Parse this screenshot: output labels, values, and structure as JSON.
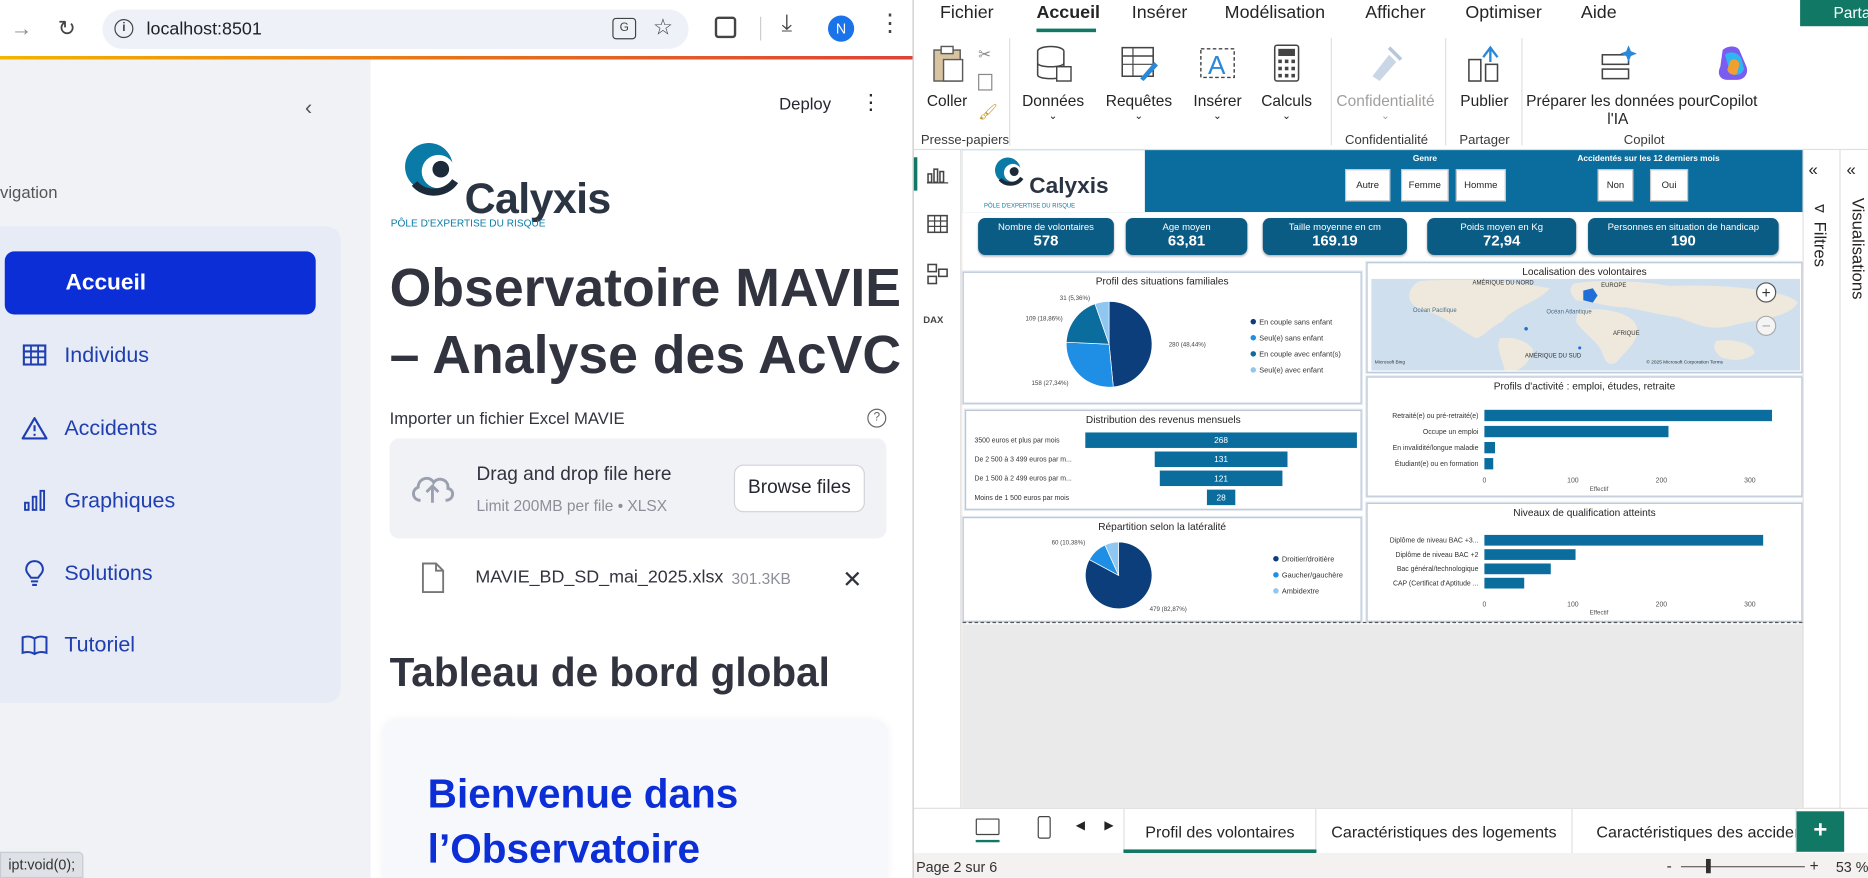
{
  "browser": {
    "url": "localhost:8501",
    "profile_initial": "N",
    "status_url": "ipt:void(0);"
  },
  "sidebar": {
    "nav_label": "vigation",
    "items": [
      {
        "label": "Accueil",
        "icon": "home",
        "active": true
      },
      {
        "label": "Individus",
        "icon": "table-icon"
      },
      {
        "label": "Accidents",
        "icon": "warning-icon"
      },
      {
        "label": "Graphiques",
        "icon": "bar-chart-icon"
      },
      {
        "label": "Solutions",
        "icon": "lightbulb-icon"
      },
      {
        "label": "Tutoriel",
        "icon": "book-icon"
      }
    ]
  },
  "app": {
    "deploy_label": "Deploy",
    "logo_text": "Calyxis",
    "logo_sub": "PÔLE D'EXPERTISE DU RISQUE",
    "title": "Observatoire MAVIE – Analyse des AcVC",
    "title_line1": "Observatoire MAVIE",
    "title_line2": "– Analyse des AcVC",
    "upload_label": "Importer un fichier Excel MAVIE",
    "drop_title": "Drag and drop file here",
    "drop_limit": "Limit 200MB per file • XLSX",
    "browse_label": "Browse files",
    "file_name": "MAVIE_BD_SD_mai_2025.xlsx",
    "file_size": "301.3KB",
    "section_title": "Tableau de bord global",
    "welcome_line1": "Bienvenue dans",
    "welcome_line2": "l’Observatoire"
  },
  "powerbi": {
    "menus": [
      "Fichier",
      "Accueil",
      "Insérer",
      "Modélisation",
      "Afficher",
      "Optimiser",
      "Aide"
    ],
    "active_menu": "Accueil",
    "share_label": "Parta",
    "ribbon": {
      "coller": "Coller",
      "presse": "Presse-papiers",
      "donnees": "Données",
      "requetes": "Requêtes",
      "inserer": "Insérer",
      "calculs": "Calculs",
      "confidentialite_btn": "Confidentialité",
      "confidentialite_grp": "Confidentialité",
      "publier": "Publier",
      "partager": "Partager",
      "copilot_btn_1": "Préparer les données pour",
      "copilot_btn_2": "l'IA",
      "copilot_btn2": "Copilot",
      "copilot_grp": "Copilot"
    },
    "right_panels": [
      "Filtres",
      "Visualisations"
    ],
    "page_tabs": [
      "Profil des volontaires",
      "Caractéristiques des logements",
      "Caractéristiques des accidents"
    ],
    "active_tab": "Profil des volontaires",
    "status_page": "Page 2 sur 6",
    "zoom": "53 %"
  },
  "report": {
    "logo_text": "Calyxis",
    "logo_sub": "PÔLE D'EXPERTISE DU RISQUE",
    "slicer_genre": {
      "title": "Genre",
      "options": [
        "Autre",
        "Femme",
        "Homme"
      ]
    },
    "slicer_accidents": {
      "title": "Accidentés sur les 12 derniers mois",
      "options": [
        "Non",
        "Oui"
      ]
    },
    "kpis": [
      {
        "label": "Nombre de volontaires",
        "value": "578"
      },
      {
        "label": "Age moyen",
        "value": "63,81"
      },
      {
        "label": "Taille moyenne en cm",
        "value": "169.19"
      },
      {
        "label": "Poids moyen en Kg",
        "value": "72,94"
      },
      {
        "label": "Personnes en situation de handicap",
        "value": "190"
      }
    ],
    "map": {
      "title": "Localisation des volontaires",
      "labels": [
        "AMÉRIQUE DU NORD",
        "EUROPE",
        "Océan Pacifique",
        "Océan Atlantique",
        "AFRIQUE",
        "AMÉRIQUE DU SUD"
      ],
      "credit_left": "Microsoft Bing",
      "credit_right": "© 2025 Microsoft Corporation   Terms"
    }
  },
  "chart_data": [
    {
      "type": "pie",
      "title": "Profil des situations familiales",
      "categories": [
        "En couple sans enfant",
        "Seul(e) sans enfant",
        "En couple avec enfant(s)",
        "Seul(e) avec enfant"
      ],
      "values": [
        280,
        158,
        109,
        31
      ],
      "data_labels": [
        "280 (48,44%)",
        "158 (27,34%)",
        "109 (18,86%)",
        "31 (5,36%)"
      ],
      "colors": [
        "#0b3e7a",
        "#1f8fe6",
        "#0b6d9e",
        "#8fc7f0"
      ],
      "legend": "right"
    },
    {
      "type": "bar",
      "orientation": "horizontal",
      "title": "Distribution des revenus mensuels",
      "categories": [
        "3500 euros et plus par mois",
        "De 2 500 à 3 499 euros par m...",
        "De 1 500 à 2 499 euros par m...",
        "Moins de 1 500 euros par mois"
      ],
      "values": [
        268,
        131,
        121,
        28
      ],
      "color": "#0b6d9e"
    },
    {
      "type": "pie",
      "title": "Répartition selon la latéralité",
      "categories": [
        "Droitier/droitière",
        "Gaucher/gauchère",
        "Ambidextre"
      ],
      "values": [
        479,
        60,
        39
      ],
      "data_labels": [
        "479 (82,87%)",
        "60 (10,38%)",
        ""
      ],
      "colors": [
        "#0b3e7a",
        "#1f8fe6",
        "#8fc7f0"
      ],
      "legend": "right"
    },
    {
      "type": "bar",
      "orientation": "horizontal",
      "title": "Profils d'activité : emploi, études, retraite",
      "categories": [
        "Retraité(e) ou pré-retraité(e)",
        "Occupe un emploi",
        "En invalidité/longue maladie",
        "Étudiant(e) ou en formation"
      ],
      "values": [
        325,
        208,
        12,
        10
      ],
      "xlabel": "Effectif",
      "xticks": [
        0,
        100,
        200,
        300
      ],
      "xlim": [
        0,
        350
      ],
      "color": "#0b6d9e"
    },
    {
      "type": "bar",
      "orientation": "horizontal",
      "title": "Niveaux de qualification atteints",
      "categories": [
        "Diplôme de niveau BAC +3...",
        "Diplôme de niveau BAC +2",
        "Bac général/technologique",
        "CAP (Certificat d'Aptitude ..."
      ],
      "values": [
        315,
        103,
        75,
        45
      ],
      "xlabel": "Effectif",
      "xticks": [
        0,
        100,
        200,
        300
      ],
      "xlim": [
        0,
        350
      ],
      "color": "#0b6d9e"
    }
  ]
}
